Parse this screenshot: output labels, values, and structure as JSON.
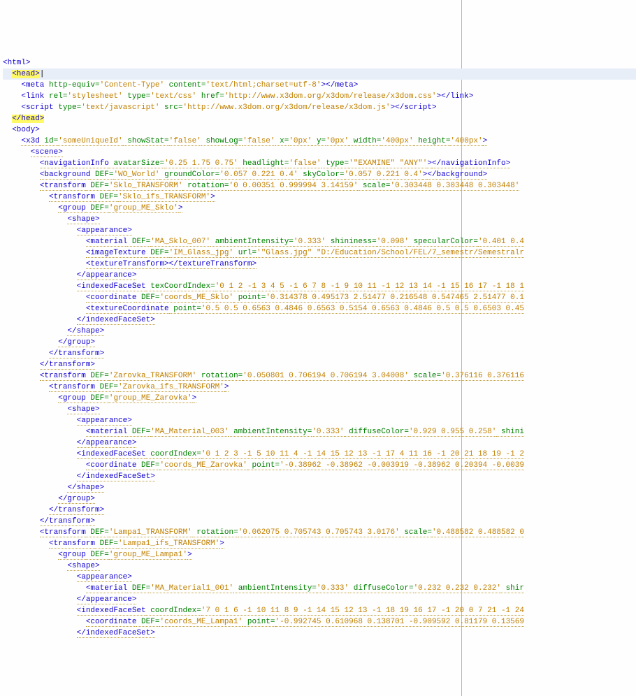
{
  "lines": [
    {
      "indent": 0,
      "segs": [
        [
          "tag",
          "<html>"
        ]
      ]
    },
    {
      "indent": 2,
      "cls": "cursor-line",
      "segs": [
        [
          "tag hl",
          "<head>"
        ],
        [
          "tx",
          "|"
        ]
      ]
    },
    {
      "indent": 4,
      "segs": [
        [
          "tag",
          "<meta "
        ],
        [
          "attr",
          "http-equiv="
        ],
        [
          "val",
          "'Content-Type'"
        ],
        [
          "attr",
          " content="
        ],
        [
          "val",
          "'text/html;charset=utf-8'"
        ],
        [
          "tag",
          ">"
        ],
        [
          "tag",
          "</meta>"
        ]
      ]
    },
    {
      "indent": 4,
      "segs": [
        [
          "tag",
          "<link "
        ],
        [
          "attr",
          "rel="
        ],
        [
          "val",
          "'stylesheet'"
        ],
        [
          "attr",
          " type="
        ],
        [
          "val",
          "'text/css'"
        ],
        [
          "attr",
          " href="
        ],
        [
          "val",
          "'http://www.x3dom.org/x3dom/release/x3dom.css'"
        ],
        [
          "tag",
          ">"
        ],
        [
          "tag",
          "</link>"
        ]
      ]
    },
    {
      "indent": 4,
      "segs": [
        [
          "tag",
          "<script "
        ],
        [
          "attr",
          "type="
        ],
        [
          "val",
          "'text/javascript'"
        ],
        [
          "attr",
          " src="
        ],
        [
          "val",
          "'http://www.x3dom.org/x3dom/release/x3dom.js'"
        ],
        [
          "tag",
          ">"
        ],
        [
          "tag",
          "</script>"
        ]
      ]
    },
    {
      "indent": 2,
      "segs": [
        [
          "tag hl",
          "</head>"
        ]
      ]
    },
    {
      "indent": 2,
      "segs": [
        [
          "tag",
          "<body>"
        ]
      ]
    },
    {
      "indent": 4,
      "segs": [
        [
          "tag du",
          "<x3d"
        ],
        [
          "attr du",
          " id="
        ],
        [
          "val du",
          "'someUniqueId'"
        ],
        [
          "attr du",
          " showStat="
        ],
        [
          "val du",
          "'false'"
        ],
        [
          "attr du",
          " showLog="
        ],
        [
          "val du",
          "'false'"
        ],
        [
          "attr du",
          " x="
        ],
        [
          "val du",
          "'0px'"
        ],
        [
          "attr du",
          " y="
        ],
        [
          "val du",
          "'0px'"
        ],
        [
          "attr du",
          " width="
        ],
        [
          "val du",
          "'400px'"
        ],
        [
          "attr du",
          " height="
        ],
        [
          "val du",
          "'400px'"
        ],
        [
          "tag du",
          ">"
        ]
      ]
    },
    {
      "indent": 6,
      "segs": [
        [
          "tag du",
          "<scene>"
        ]
      ]
    },
    {
      "indent": 8,
      "segs": [
        [
          "tag du",
          "<navigationInfo"
        ],
        [
          "attr du",
          " avatarSize="
        ],
        [
          "val du",
          "'0.25 1.75 0.75'"
        ],
        [
          "attr du",
          " headlight="
        ],
        [
          "val du",
          "'false'"
        ],
        [
          "attr du",
          " type="
        ],
        [
          "val du",
          "'\"EXAMINE\" \"ANY\"'"
        ],
        [
          "tag du",
          ">"
        ],
        [
          "tag du",
          "</navigationInfo>"
        ]
      ]
    },
    {
      "indent": 8,
      "segs": [
        [
          "tag du",
          "<background"
        ],
        [
          "attr du",
          " DEF="
        ],
        [
          "val du",
          "'WO_World'"
        ],
        [
          "attr du",
          " groundColor="
        ],
        [
          "val du",
          "'0.057 0.221 0.4'"
        ],
        [
          "attr du",
          " skyColor="
        ],
        [
          "val du",
          "'0.057 0.221 0.4'"
        ],
        [
          "tag du",
          ">"
        ],
        [
          "tag du",
          "</background>"
        ]
      ]
    },
    {
      "indent": 8,
      "segs": [
        [
          "tag du",
          "<transform"
        ],
        [
          "attr du",
          " DEF="
        ],
        [
          "val du",
          "'Sklo_TRANSFORM'"
        ],
        [
          "attr du",
          " rotation="
        ],
        [
          "val du",
          "'0 0.00351 0.999994 3.14159'"
        ],
        [
          "attr du",
          " scale="
        ],
        [
          "val du",
          "'0.303448 0.303448 0.303448'"
        ]
      ]
    },
    {
      "indent": 10,
      "segs": [
        [
          "tag du",
          "<transform"
        ],
        [
          "attr du",
          " DEF="
        ],
        [
          "val du",
          "'Sklo_ifs_TRANSFORM'"
        ],
        [
          "tag du",
          ">"
        ]
      ]
    },
    {
      "indent": 12,
      "segs": [
        [
          "tag du",
          "<group"
        ],
        [
          "attr du",
          " DEF="
        ],
        [
          "val du",
          "'group_ME_Sklo'"
        ],
        [
          "tag du",
          ">"
        ]
      ]
    },
    {
      "indent": 14,
      "segs": [
        [
          "tag du",
          "<shape>"
        ]
      ]
    },
    {
      "indent": 16,
      "segs": [
        [
          "tag du",
          "<appearance>"
        ]
      ]
    },
    {
      "indent": 18,
      "segs": [
        [
          "tag du",
          "<material"
        ],
        [
          "attr du",
          " DEF="
        ],
        [
          "val du",
          "'MA_Sklo_007'"
        ],
        [
          "attr du",
          " ambientIntensity="
        ],
        [
          "val du",
          "'0.333'"
        ],
        [
          "attr du",
          " shininess="
        ],
        [
          "val du",
          "'0.098'"
        ],
        [
          "attr du",
          " specularColor="
        ],
        [
          "val du",
          "'0.401 0.4"
        ]
      ]
    },
    {
      "indent": 18,
      "segs": [
        [
          "tag du",
          "<imageTexture"
        ],
        [
          "attr du",
          " DEF="
        ],
        [
          "val du",
          "'IM_Glass_jpg'"
        ],
        [
          "attr du",
          " url="
        ],
        [
          "val du",
          "'\"Glass.jpg\" \"D:/Education/School/FEL/7_semestr/Semestralr"
        ]
      ]
    },
    {
      "indent": 18,
      "segs": [
        [
          "tag du",
          "<textureTransform>"
        ],
        [
          "tag du",
          "</textureTransform>"
        ]
      ]
    },
    {
      "indent": 16,
      "segs": [
        [
          "tag du",
          "</appearance>"
        ]
      ]
    },
    {
      "indent": 16,
      "segs": [
        [
          "tag du",
          "<indexedFaceSet"
        ],
        [
          "attr du",
          " texCoordIndex="
        ],
        [
          "val du",
          "'0 1 2 -1 3 4 5 -1 6 7 8 -1 9 10 11 -1 12 13 14 -1 15 16 17 -1 18 1"
        ]
      ]
    },
    {
      "indent": 18,
      "segs": [
        [
          "tag du",
          "<coordinate"
        ],
        [
          "attr du",
          " DEF="
        ],
        [
          "val du",
          "'coords_ME_Sklo'"
        ],
        [
          "attr du",
          " point="
        ],
        [
          "val du",
          "'0.314378 0.495173 2.51477 0.216548 0.547465 2.51477 0.1"
        ]
      ]
    },
    {
      "indent": 18,
      "segs": [
        [
          "tag du",
          "<textureCoordinate"
        ],
        [
          "attr du",
          " point="
        ],
        [
          "val du",
          "'0.5 0.5 0.6563 0.4846 0.6563 0.5154 0.6563 0.4846 0.5 0.5 0.6503 0.45"
        ]
      ]
    },
    {
      "indent": 16,
      "segs": [
        [
          "tag du",
          "</indexedFaceSet>"
        ]
      ]
    },
    {
      "indent": 14,
      "segs": [
        [
          "tag du",
          "</shape>"
        ]
      ]
    },
    {
      "indent": 12,
      "segs": [
        [
          "tag du",
          "</group>"
        ]
      ]
    },
    {
      "indent": 10,
      "segs": [
        [
          "tag du",
          "</transform>"
        ]
      ]
    },
    {
      "indent": 8,
      "segs": [
        [
          "tag du",
          "</transform>"
        ]
      ]
    },
    {
      "indent": 8,
      "segs": [
        [
          "tag du",
          "<transform"
        ],
        [
          "attr du",
          " DEF="
        ],
        [
          "val du",
          "'Zarovka_TRANSFORM'"
        ],
        [
          "attr du",
          " rotation="
        ],
        [
          "val du",
          "'0.050801 0.706194 0.706194 3.04008'"
        ],
        [
          "attr du",
          " scale="
        ],
        [
          "val du",
          "'0.376116 0.376116"
        ]
      ]
    },
    {
      "indent": 10,
      "segs": [
        [
          "tag du",
          "<transform"
        ],
        [
          "attr du",
          " DEF="
        ],
        [
          "val du",
          "'Zarovka_ifs_TRANSFORM'"
        ],
        [
          "tag du",
          ">"
        ]
      ]
    },
    {
      "indent": 12,
      "segs": [
        [
          "tag du",
          "<group"
        ],
        [
          "attr du",
          " DEF="
        ],
        [
          "val du",
          "'group_ME_Zarovka'"
        ],
        [
          "tag du",
          ">"
        ]
      ]
    },
    {
      "indent": 14,
      "segs": [
        [
          "tag du",
          "<shape>"
        ]
      ]
    },
    {
      "indent": 16,
      "segs": [
        [
          "tag du",
          "<appearance>"
        ]
      ]
    },
    {
      "indent": 18,
      "segs": [
        [
          "tag du",
          "<material"
        ],
        [
          "attr du",
          " DEF="
        ],
        [
          "val du",
          "'MA_Material_003'"
        ],
        [
          "attr du",
          " ambientIntensity="
        ],
        [
          "val du",
          "'0.333'"
        ],
        [
          "attr du",
          " diffuseColor="
        ],
        [
          "val du",
          "'0.929 0.955 0.258'"
        ],
        [
          "attr du",
          " shini"
        ]
      ]
    },
    {
      "indent": 16,
      "segs": [
        [
          "tag du",
          "</appearance>"
        ]
      ]
    },
    {
      "indent": 16,
      "segs": [
        [
          "tag du",
          "<indexedFaceSet"
        ],
        [
          "attr du",
          " coordIndex="
        ],
        [
          "val du",
          "'0 1 2 3 -1 5 10 11 4 -1 14 15 12 13 -1 17 4 11 16 -1 20 21 18 19 -1 2"
        ]
      ]
    },
    {
      "indent": 18,
      "segs": [
        [
          "tag du",
          "<coordinate"
        ],
        [
          "attr du",
          " DEF="
        ],
        [
          "val du",
          "'coords_ME_Zarovka'"
        ],
        [
          "attr du",
          " point="
        ],
        [
          "val du",
          "'-0.38962 -0.38962 -0.003919 -0.38962 0.20394 -0.0039"
        ]
      ]
    },
    {
      "indent": 16,
      "segs": [
        [
          "tag du",
          "</indexedFaceSet>"
        ]
      ]
    },
    {
      "indent": 14,
      "segs": [
        [
          "tag du",
          "</shape>"
        ]
      ]
    },
    {
      "indent": 12,
      "segs": [
        [
          "tag du",
          "</group>"
        ]
      ]
    },
    {
      "indent": 10,
      "segs": [
        [
          "tag du",
          "</transform>"
        ]
      ]
    },
    {
      "indent": 8,
      "segs": [
        [
          "tag du",
          "</transform>"
        ]
      ]
    },
    {
      "indent": 8,
      "segs": [
        [
          "tag du",
          "<transform"
        ],
        [
          "attr du",
          " DEF="
        ],
        [
          "val du",
          "'Lampa1_TRANSFORM'"
        ],
        [
          "attr du",
          " rotation="
        ],
        [
          "val du",
          "'0.062075 0.705743 0.705743 3.0176'"
        ],
        [
          "attr du",
          " scale="
        ],
        [
          "val du",
          "'0.488582 0.488582 0"
        ]
      ]
    },
    {
      "indent": 10,
      "segs": [
        [
          "tag du",
          "<transform"
        ],
        [
          "attr du",
          " DEF="
        ],
        [
          "val du",
          "'Lampa1_ifs_TRANSFORM'"
        ],
        [
          "tag du",
          ">"
        ]
      ]
    },
    {
      "indent": 12,
      "segs": [
        [
          "tag du",
          "<group"
        ],
        [
          "attr du",
          " DEF="
        ],
        [
          "val du",
          "'group_ME_Lampa1'"
        ],
        [
          "tag du",
          ">"
        ]
      ]
    },
    {
      "indent": 14,
      "segs": [
        [
          "tag du",
          "<shape>"
        ]
      ]
    },
    {
      "indent": 16,
      "segs": [
        [
          "tag du",
          "<appearance>"
        ]
      ]
    },
    {
      "indent": 18,
      "segs": [
        [
          "tag du",
          "<material"
        ],
        [
          "attr du",
          " DEF="
        ],
        [
          "val du",
          "'MA_Material1_001'"
        ],
        [
          "attr du",
          " ambientIntensity="
        ],
        [
          "val du",
          "'0.333'"
        ],
        [
          "attr du",
          " diffuseColor="
        ],
        [
          "val du",
          "'0.232 0.232 0.232'"
        ],
        [
          "attr du",
          " shir"
        ]
      ]
    },
    {
      "indent": 16,
      "segs": [
        [
          "tag du",
          "</appearance>"
        ]
      ]
    },
    {
      "indent": 16,
      "segs": [
        [
          "tag du",
          "<indexedFaceSet"
        ],
        [
          "attr du",
          " coordIndex="
        ],
        [
          "val du",
          "'7 0 1 6 -1 10 11 8 9 -1 14 15 12 13 -1 18 19 16 17 -1 20 0 7 21 -1 24"
        ]
      ]
    },
    {
      "indent": 18,
      "segs": [
        [
          "tag du",
          "<coordinate"
        ],
        [
          "attr du",
          " DEF="
        ],
        [
          "val du",
          "'coords_ME_Lampa1'"
        ],
        [
          "attr du",
          " point="
        ],
        [
          "val du",
          "'-0.992745 0.610968 0.138701 -0.909592 0.81179 0.13569"
        ]
      ]
    },
    {
      "indent": 16,
      "segs": [
        [
          "tag du",
          "</indexedFaceSet>"
        ]
      ]
    }
  ]
}
